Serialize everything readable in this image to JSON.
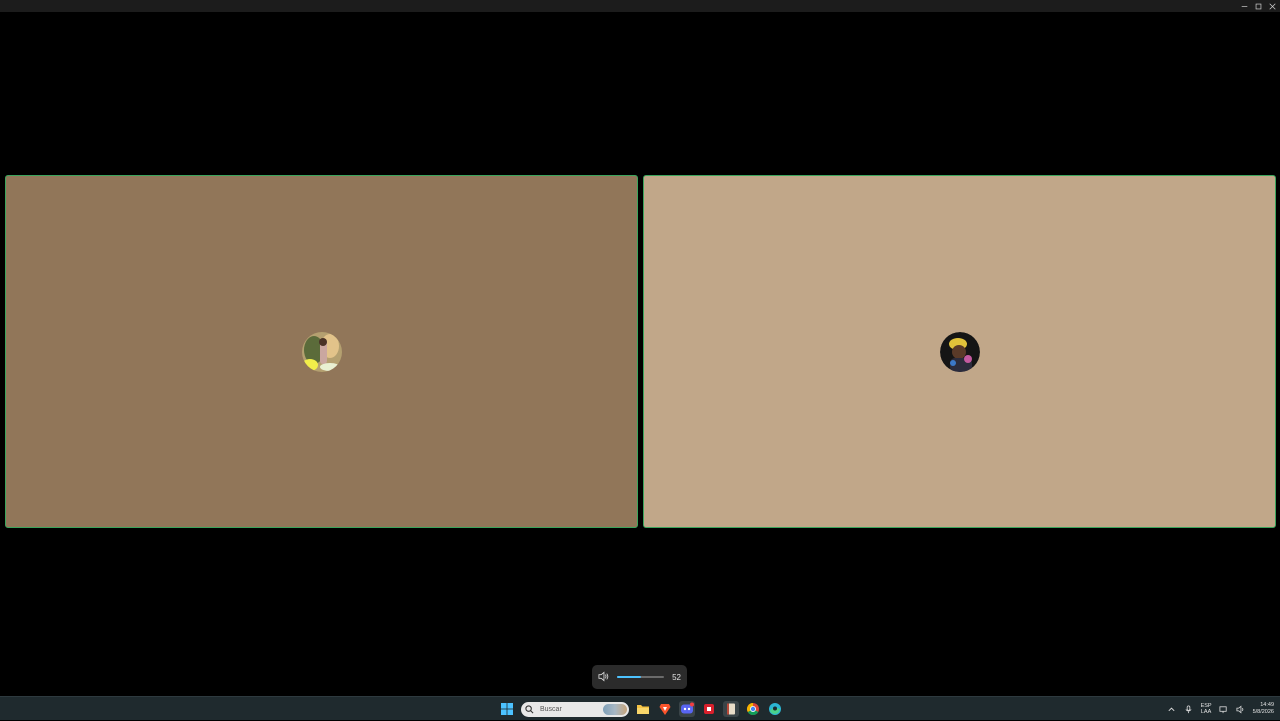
{
  "window": {
    "controls": [
      "minimize-icon",
      "maximize-icon",
      "close-icon"
    ]
  },
  "call": {
    "participants": [
      {
        "avatar": "user-avatar-1",
        "tile_color": "#917659"
      },
      {
        "avatar": "user-avatar-2",
        "tile_color": "#c1a789"
      }
    ],
    "speaking_border_color": "#3ba55c"
  },
  "volume_popup": {
    "icon": "speaker-icon",
    "value": "52",
    "level": 0.52,
    "accent": "#4cc2ff"
  },
  "taskbar": {
    "search_placeholder": "Buscar",
    "apps": [
      "start-icon",
      "search-icon",
      "file-explorer-icon",
      "brave-browser-icon",
      "discord-icon",
      "red-app-icon",
      "book-app-icon",
      "chrome-icon",
      "edge-icon"
    ],
    "tray": {
      "language_line1": "ESP",
      "language_line2": "LAA",
      "time": "14:49",
      "date": "5/8/2026"
    }
  }
}
